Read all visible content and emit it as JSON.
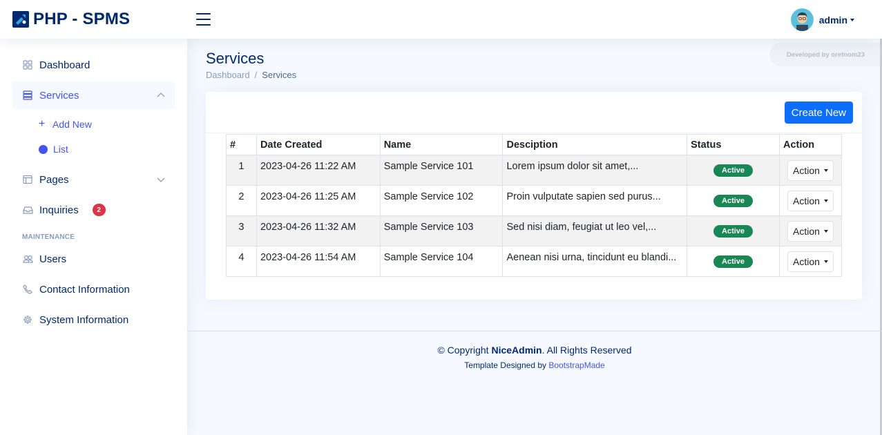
{
  "header": {
    "logo_text": "PHP - SPMS",
    "user_name": "admin"
  },
  "dev_badge": "Developed by oretnom23",
  "sidebar": {
    "items": [
      {
        "label": "Dashboard"
      },
      {
        "label": "Services"
      },
      {
        "label": "Pages"
      },
      {
        "label": "Inquiries",
        "badge": "2"
      },
      {
        "label": "Users"
      },
      {
        "label": "Contact Information"
      },
      {
        "label": "System Information"
      }
    ],
    "sub_items": [
      {
        "label": "Add New"
      },
      {
        "label": "List"
      }
    ],
    "heading": "Maintenance"
  },
  "page": {
    "title": "Services",
    "breadcrumb": [
      "Dashboard",
      "/",
      "Services"
    ]
  },
  "toolbar": {
    "create_label": "Create New"
  },
  "table": {
    "headers": [
      "#",
      "Date Created",
      "Name",
      "Desciption",
      "Status",
      "Action"
    ],
    "rows": [
      {
        "num": "1",
        "date": "2023-04-26 11:22 AM",
        "name": "Sample Service 101",
        "desc": "Lorem ipsum dolor sit amet,...",
        "status": "Active",
        "action": "Action"
      },
      {
        "num": "2",
        "date": "2023-04-26 11:25 AM",
        "name": "Sample Service 102",
        "desc": "Proin vulputate sapien sed purus...",
        "status": "Active",
        "action": "Action"
      },
      {
        "num": "3",
        "date": "2023-04-26 11:32 AM",
        "name": "Sample Service 103",
        "desc": "Sed nisi diam, feugiat ut leo vel,...",
        "status": "Active",
        "action": "Action"
      },
      {
        "num": "4",
        "date": "2023-04-26 11:54 AM",
        "name": "Sample Service 104",
        "desc": "Aenean nisi urna, tincidunt eu blandi...",
        "status": "Active",
        "action": "Action"
      }
    ]
  },
  "footer": {
    "copy_prefix": "© Copyright",
    "brand": "NiceAdmin",
    "copy_suffix": ". All Rights Reserved",
    "credits_prefix": "Template Designed by",
    "credits_link": "BootstrapMade"
  },
  "colors": {
    "primary": "#4154f1",
    "navy": "#012970",
    "button_blue": "#0d6efd",
    "success": "#198754",
    "danger": "#dc3545"
  }
}
